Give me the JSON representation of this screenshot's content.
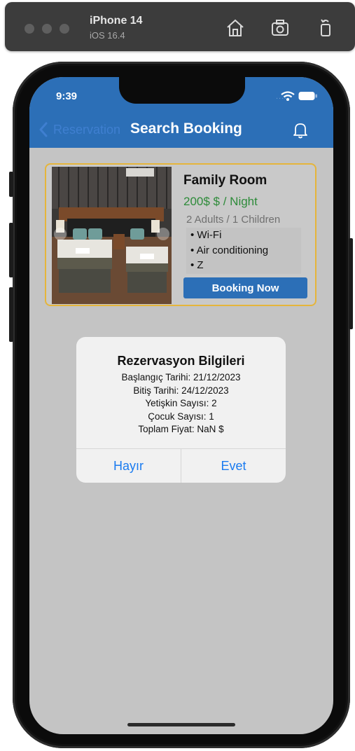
{
  "simulator": {
    "device_name": "iPhone 14",
    "os_version": "iOS 16.4"
  },
  "status_bar": {
    "time": "9:39",
    "signal": "....."
  },
  "nav": {
    "back_label": "Reservation",
    "title": "Search Booking"
  },
  "room": {
    "title": "Family Room",
    "price": "200$ $ / Night",
    "occupancy": "2 Adults / 1 Children",
    "amenities": [
      "• Wi-Fi",
      "• Air conditioning",
      "• Z"
    ],
    "book_label": "Booking Now"
  },
  "alert": {
    "title": "Rezervasyon Bilgileri",
    "lines": [
      "Başlangıç Tarihi: 21/12/2023",
      "Bitiş Tarihi: 24/12/2023",
      "Yetişkin Sayısı: 2",
      "Çocuk Sayısı: 1",
      "Toplam Fiyat: NaN $"
    ],
    "cancel_label": "Hayır",
    "confirm_label": "Evet"
  },
  "icons": [
    "home-icon",
    "screenshot-icon",
    "rotate-icon",
    "back-chevron-icon",
    "bell-icon",
    "wifi-icon",
    "battery-icon"
  ],
  "colors": {
    "nav_blue": "#2c6fb7",
    "price_green": "#2e8b3a",
    "card_border": "#e5b53b",
    "alert_button": "#1a7bf0"
  }
}
